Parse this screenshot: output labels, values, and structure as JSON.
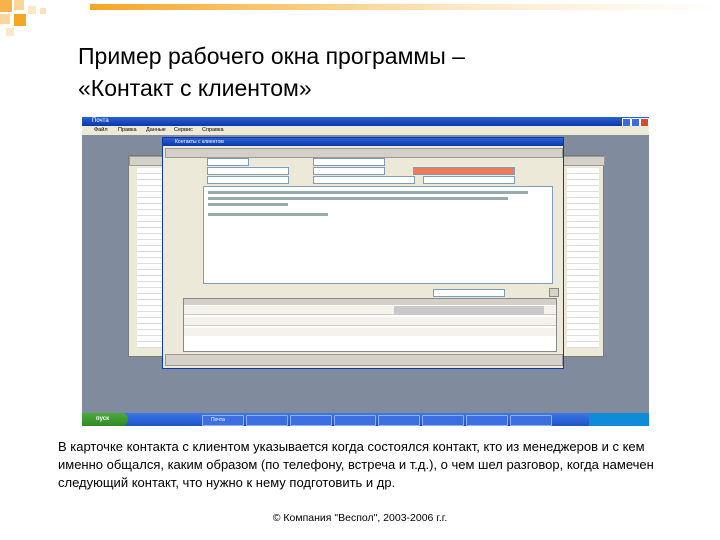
{
  "slide": {
    "title_line1": "Пример рабочего окна программы –",
    "title_line2": "«Контакт с клиентом»",
    "description": "В карточке контакта с клиентом указывается когда состоялся контакт, кто из менеджеров и с кем именно общался, каким образом (по телефону, встреча и т.д.), о чем шел разговор, когда намечен следующий контакт, что нужно к нему подготовить  и др.",
    "footer": "© Компания \"Веспол\", 2003-2006 г.г."
  },
  "screenshot": {
    "app_title": "Почта",
    "menu": [
      "Файл",
      "Правка",
      "Данные",
      "Сервис",
      "Справка"
    ],
    "dialog_title": "Контакты с клиентом",
    "taskbar": {
      "start_label": "пуск",
      "item_label": "Почта"
    }
  },
  "colors": {
    "xp_blue": "#0b3aa8",
    "highlight": "#f07a5a",
    "start_green": "#2f8a24",
    "deco_orange": "#f5a623"
  }
}
